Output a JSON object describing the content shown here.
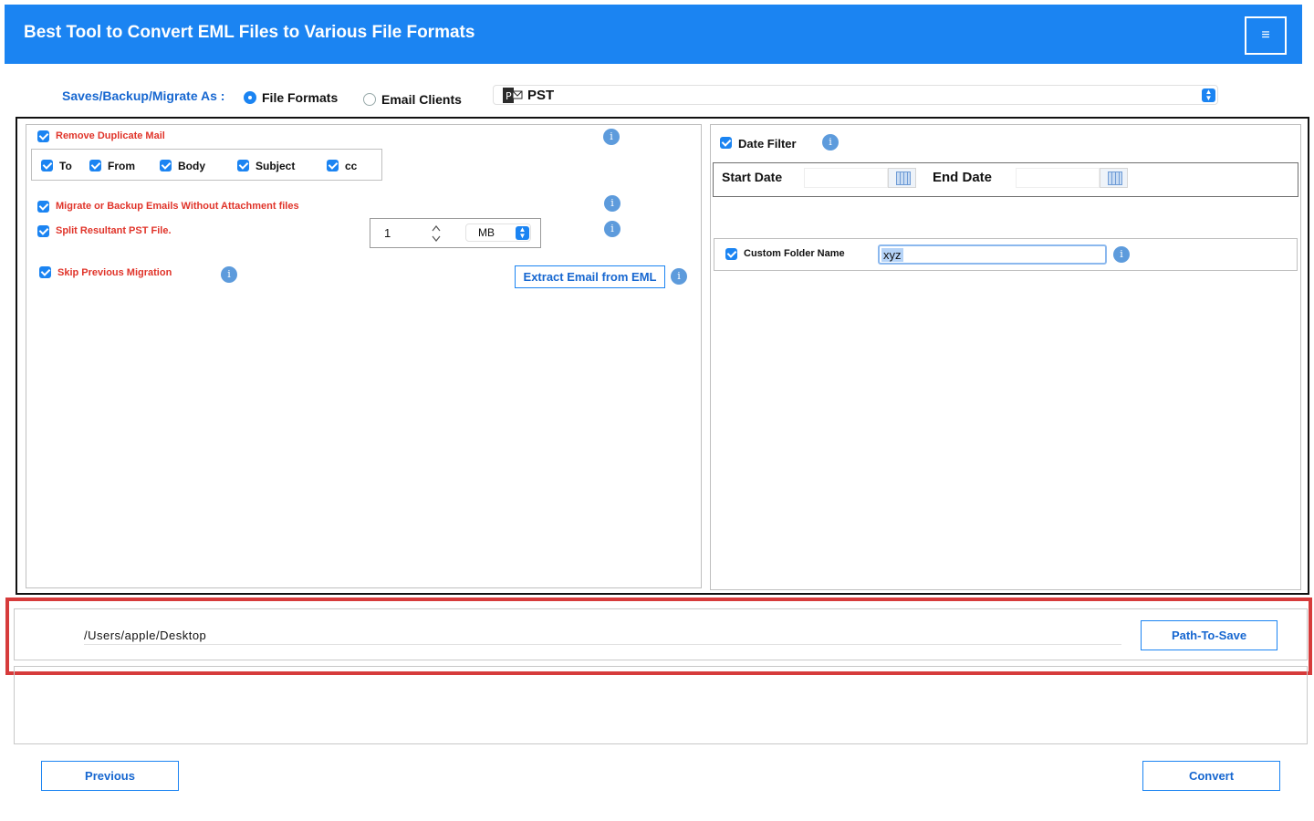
{
  "header": {
    "title": "Best Tool to Convert EML Files to Various File Formats",
    "menu_icon": "≡"
  },
  "saves": {
    "label": "Saves/Backup/Migrate As :",
    "options": [
      {
        "label": "File Formats",
        "selected": true
      },
      {
        "label": "Email Clients",
        "selected": false
      }
    ],
    "format_value": "PST",
    "format_icon_letter": "P"
  },
  "left": {
    "remove_duplicate": {
      "label": "Remove Duplicate Mail",
      "checked": true
    },
    "fields": [
      {
        "label": "To",
        "checked": true
      },
      {
        "label": "From",
        "checked": true
      },
      {
        "label": "Body",
        "checked": true
      },
      {
        "label": "Subject",
        "checked": true
      },
      {
        "label": "cc",
        "checked": true
      }
    ],
    "without_attachment": {
      "label": "Migrate or Backup Emails Without Attachment files",
      "checked": true
    },
    "split": {
      "label": "Split Resultant PST File.",
      "checked": true,
      "value": "1",
      "unit": "MB"
    },
    "skip_previous": {
      "label": "Skip Previous Migration",
      "checked": true
    },
    "extract_button": "Extract Email from EML",
    "info_glyph": "i"
  },
  "right": {
    "date_filter": {
      "label": "Date Filter",
      "checked": true
    },
    "start_date_label": "Start Date",
    "end_date_label": "End Date",
    "start_date_value": "",
    "end_date_value": "",
    "custom_folder": {
      "label": "Custom Folder Name",
      "checked": true,
      "value": "xyz"
    }
  },
  "path": {
    "value": "/Users/apple/Desktop",
    "button": "Path-To-Save"
  },
  "footer": {
    "previous": "Previous",
    "convert": "Convert"
  },
  "colors": {
    "header_bg": "#1b84f2",
    "accent": "#1767d0",
    "warning_label": "#e0342a",
    "highlight_border": "#d63b3b"
  }
}
